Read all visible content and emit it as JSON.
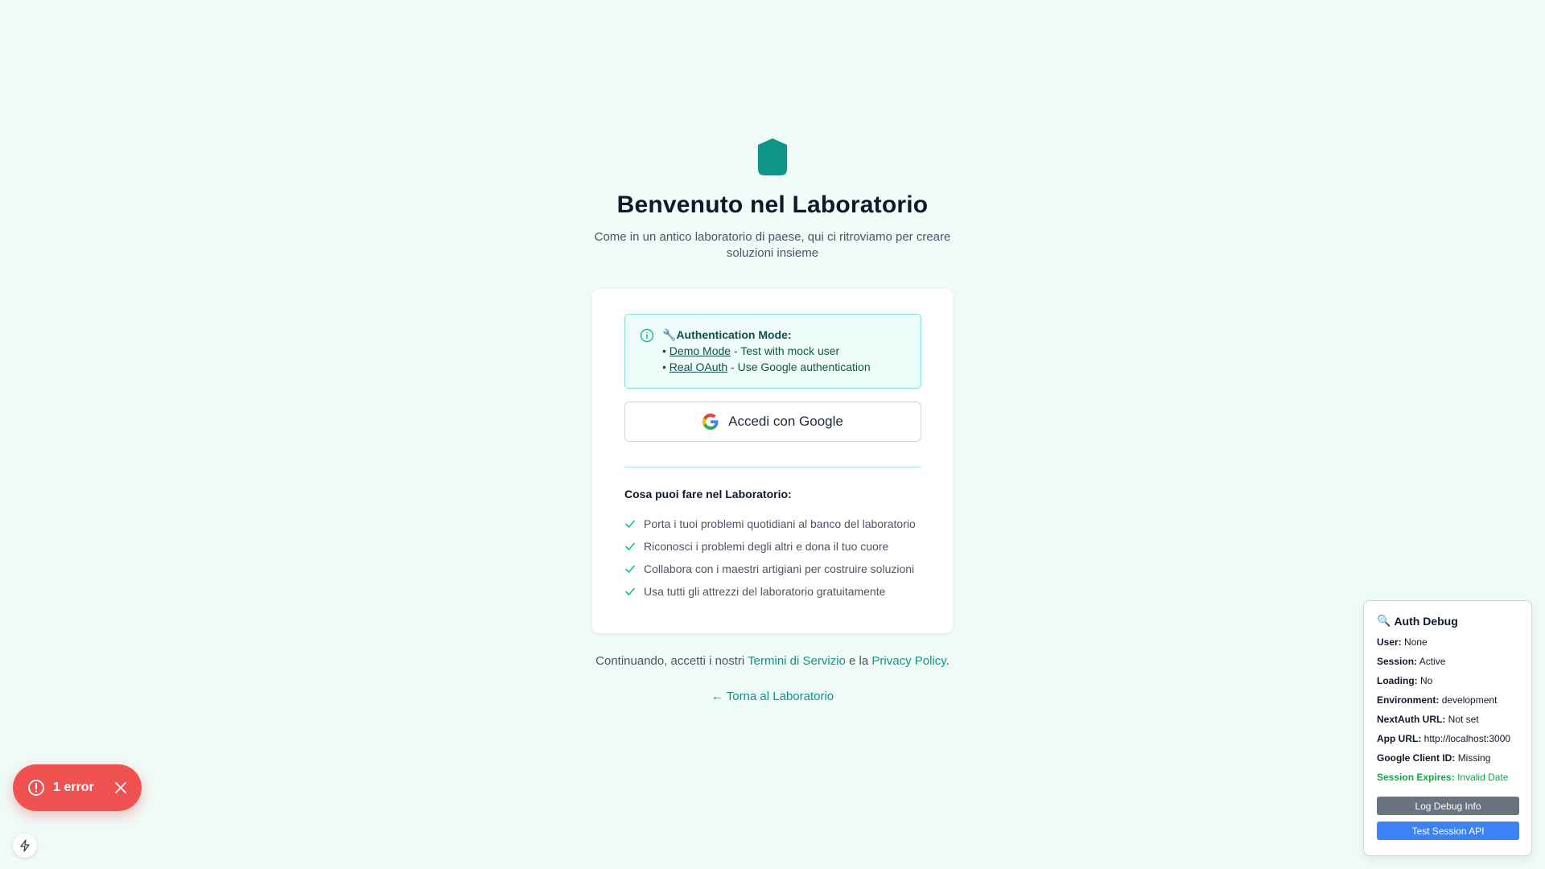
{
  "brand": {
    "accent": "#0f9488",
    "logo_icon": "shield-icon"
  },
  "header": {
    "title": "Benvenuto nel Laboratorio",
    "subtitle": "Come in un antico laboratorio di paese, qui ci ritroviamo per creare soluzioni insieme"
  },
  "auth_info": {
    "icon": "info-icon",
    "heading_emoji": "🔧",
    "heading": "Authentication Mode:",
    "modes": [
      {
        "bullet": "•",
        "link": "Demo Mode",
        "desc": " - Test with mock user"
      },
      {
        "bullet": "•",
        "link": "Real OAuth",
        "desc": " - Use Google authentication"
      }
    ]
  },
  "google_button": {
    "label": "Accedi con Google",
    "icon": "google-icon"
  },
  "features": {
    "title": "Cosa puoi fare nel Laboratorio:",
    "items": [
      "Porta i tuoi problemi quotidiani al banco del laboratorio",
      "Riconosci i problemi degli altri e dona il tuo cuore",
      "Collabora con i maestri artigiani per costruire soluzioni",
      "Usa tutti gli attrezzi del laboratorio gratuitamente"
    ]
  },
  "terms": {
    "prefix": "Continuando, accetti i nostri ",
    "tos": "Termini di Servizio",
    "middle": " e la ",
    "privacy": "Privacy Policy",
    "suffix": "."
  },
  "back_link": "← Torna al Laboratorio",
  "error_toast": {
    "label": "1 error",
    "color": "#f05252"
  },
  "debug": {
    "emoji": "🔍",
    "title": "Auth Debug",
    "rows": [
      {
        "key": "User:",
        "value": "None"
      },
      {
        "key": "Session:",
        "value": "Active"
      },
      {
        "key": "Loading:",
        "value": "No"
      },
      {
        "key": "Environment:",
        "value": "development"
      },
      {
        "key": "NextAuth URL:",
        "value": "Not set"
      },
      {
        "key": "App URL:",
        "value": "http://localhost:3000"
      },
      {
        "key": "Google Client ID:",
        "value": "Missing"
      },
      {
        "key": "Session Expires:",
        "value": "Invalid Date"
      }
    ],
    "log_button": "Log Debug Info",
    "test_button": "Test Session API"
  }
}
